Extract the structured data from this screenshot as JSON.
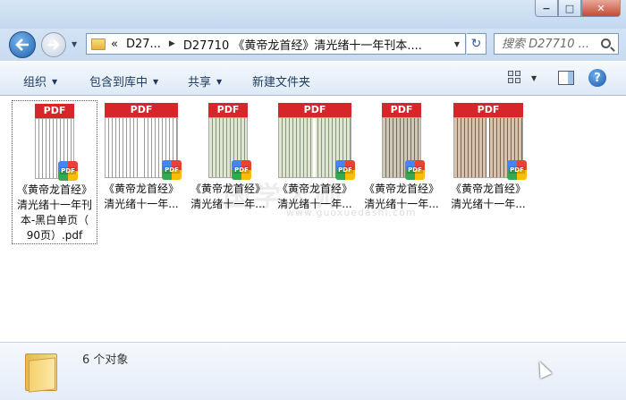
{
  "window": {
    "minimize_glyph": "−",
    "maximize_glyph": "□",
    "close_glyph": "✕"
  },
  "nav": {
    "breadcrumb": [
      {
        "label": "«"
      },
      {
        "label": "D27..."
      },
      {
        "label": "D27710 《黄帝龙首经》清光绪十一年刊本...."
      }
    ],
    "search_placeholder": "搜索 D27710 ...",
    "refresh_glyph": "↻"
  },
  "toolbar": {
    "organize": "组织",
    "include_in_library": "包含到库中",
    "share": "共享",
    "new_folder": "新建文件夹",
    "help": "?"
  },
  "files": [
    {
      "badge": "PDF",
      "line1": "《黄帝龙首经》",
      "line2": "清光绪十一年刊",
      "line3": "本-黑白单页（",
      "line4": "90页）.pdf",
      "selected": true,
      "style": "bw"
    },
    {
      "badge": "PDF",
      "line1": "《黄帝龙首经》",
      "line2": "清光绪十一年...",
      "style": "bw"
    },
    {
      "badge": "PDF",
      "line1": "《黄帝龙首经》",
      "line2": "清光绪十一年...",
      "style": "green"
    },
    {
      "badge": "PDF",
      "line1": "《黄帝龙首经》",
      "line2": "清光绪十一年...",
      "style": "green"
    },
    {
      "badge": "PDF",
      "line1": "《黄帝龙首经》",
      "line2": "清光绪十一年...",
      "style": "tan"
    },
    {
      "badge": "PDF",
      "line1": "《黄帝龙首经》",
      "line2": "清光绪十一年...",
      "style": "brown"
    }
  ],
  "watermark": {
    "text": "国学大师",
    "sub": "www.guoxuedashi.com"
  },
  "details": {
    "count": "6 个对象"
  },
  "icons": [
    "back-arrow-icon",
    "forward-arrow-icon",
    "folder-icon",
    "refresh-icon",
    "search-icon",
    "view-icon",
    "preview-pane-icon",
    "help-icon",
    "pdf-icon"
  ],
  "colors": {
    "pdf_red": "#d6262a",
    "toolbar_text": "#1e3a5c"
  }
}
